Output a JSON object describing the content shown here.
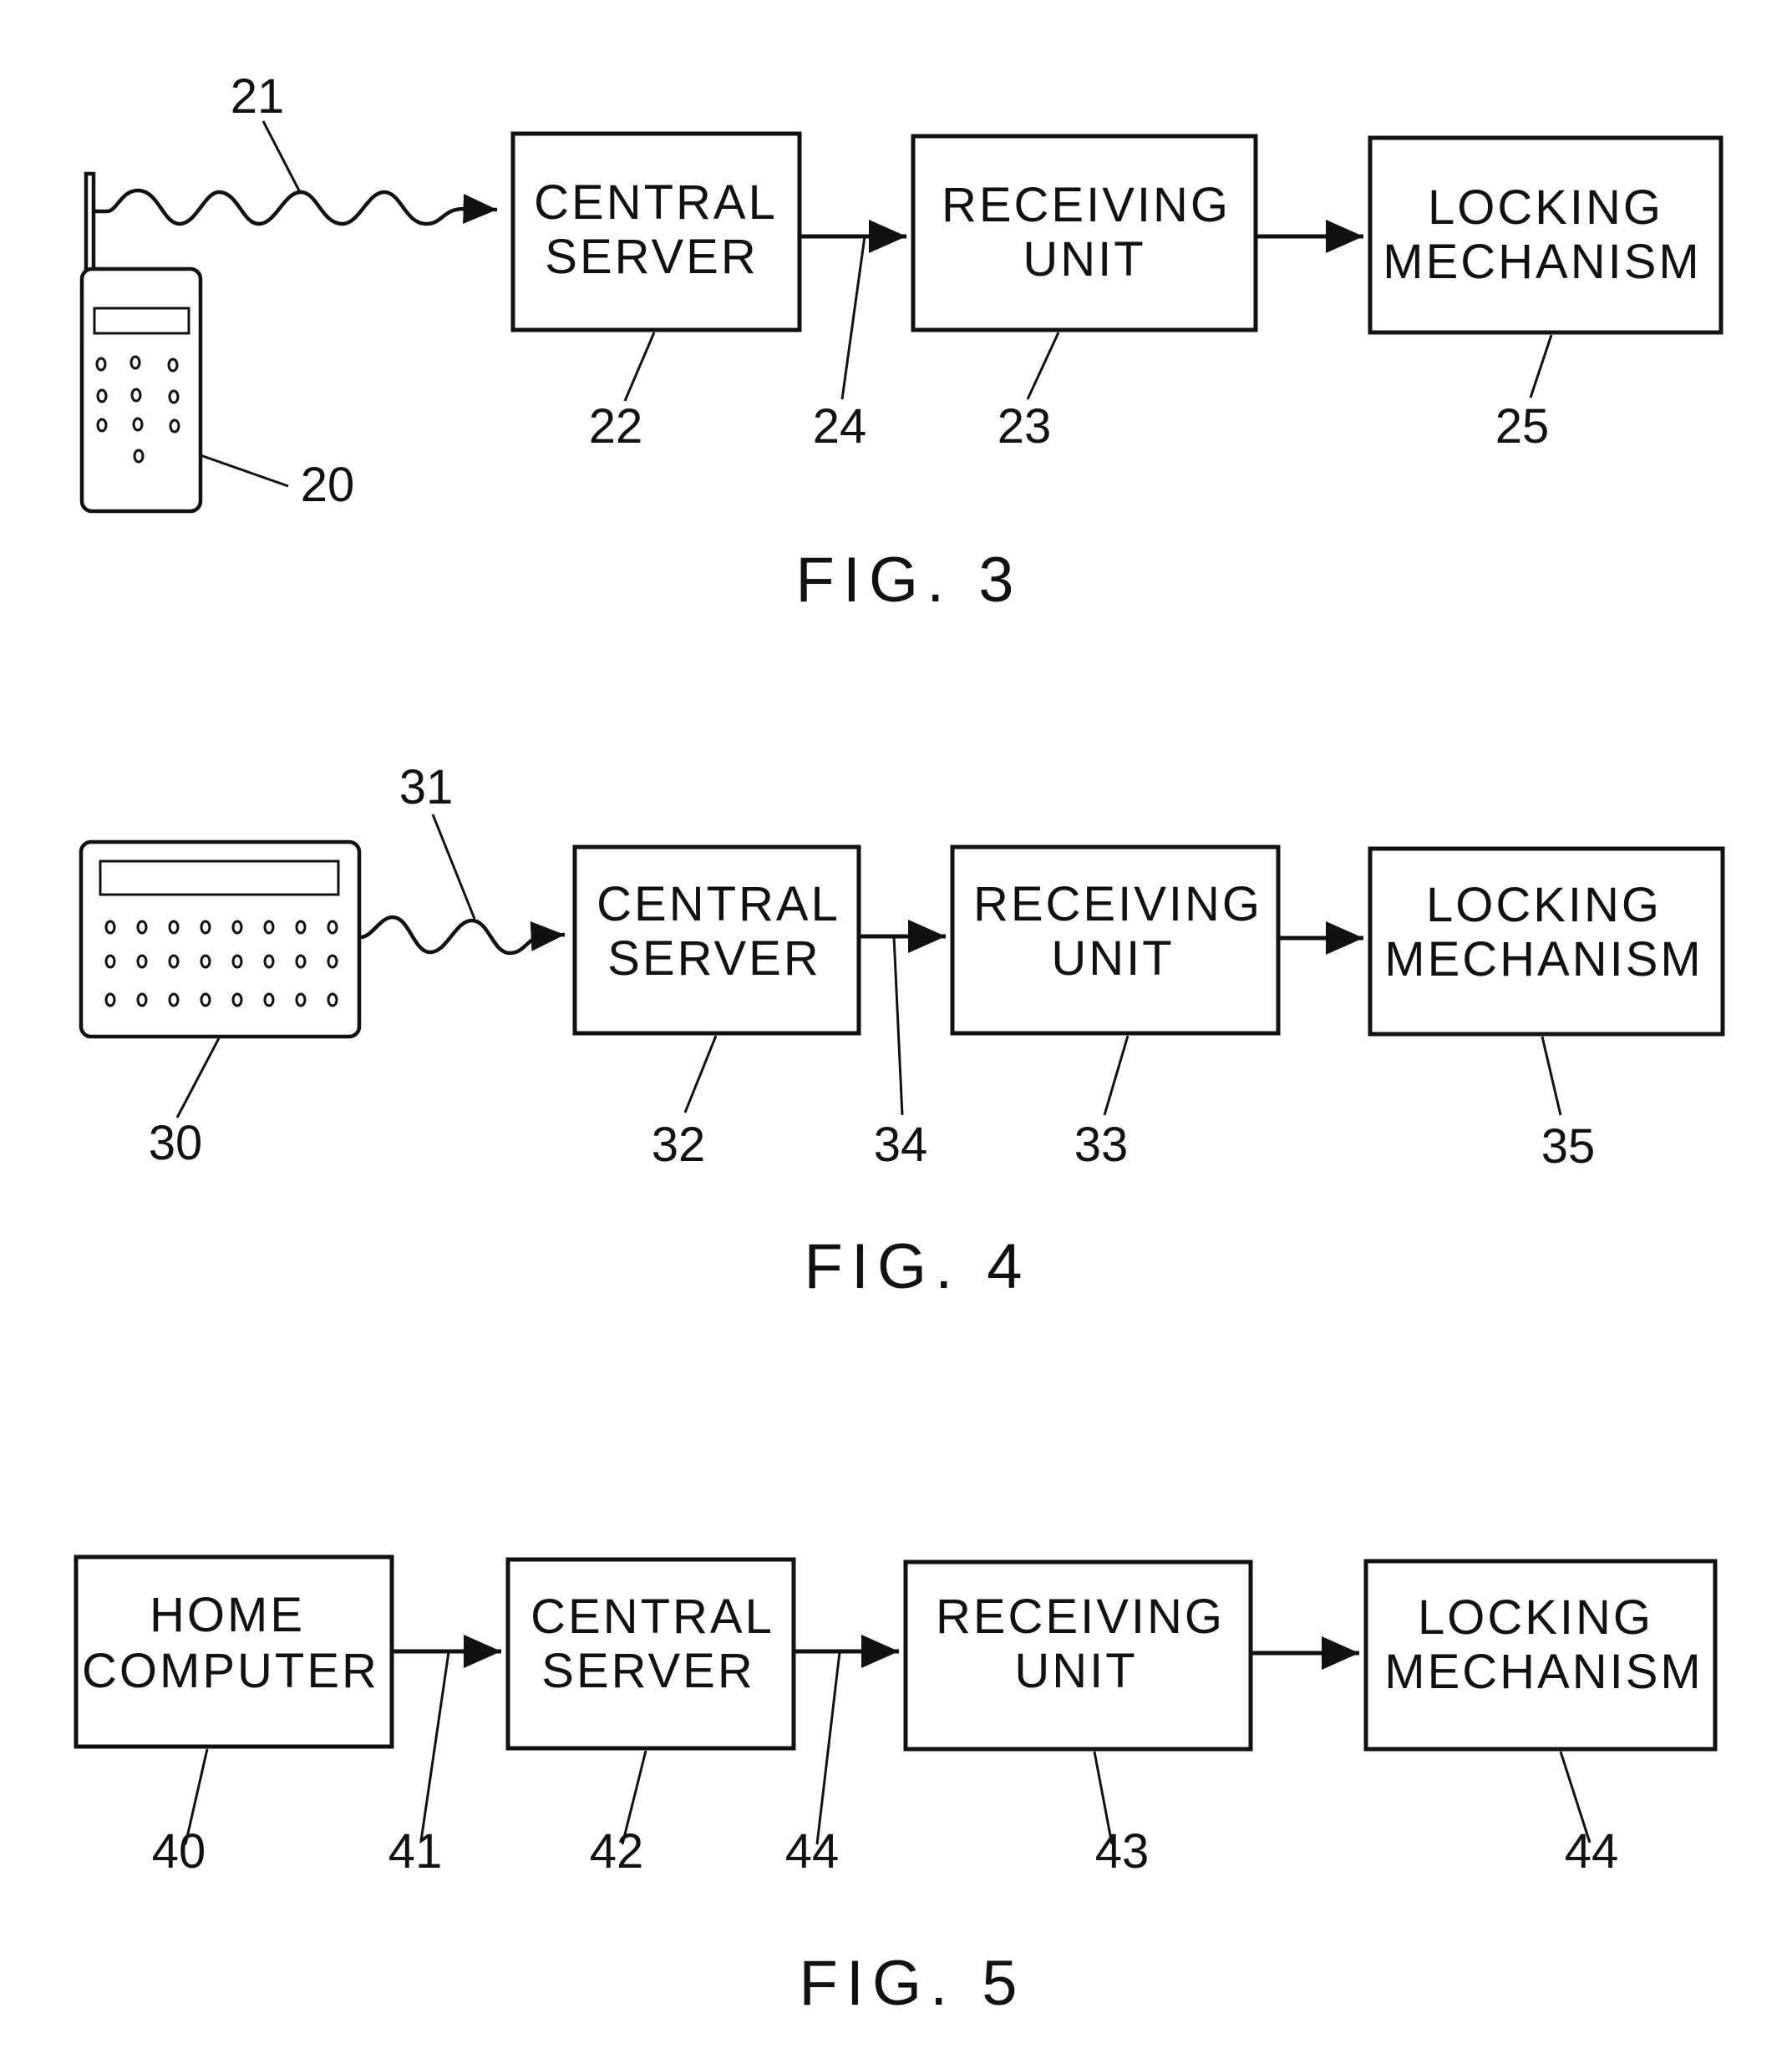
{
  "figures": [
    {
      "label": "FIG. 3",
      "source_device": {
        "type": "mobile-phone",
        "ref": "20"
      },
      "link_ref": "21",
      "link_type": "wireless",
      "blocks": [
        {
          "ref": "22",
          "lines": [
            "CENTRAL",
            "SERVER"
          ]
        },
        {
          "ref": "23",
          "lines": [
            "RECEIVING",
            "UNIT"
          ]
        },
        {
          "ref": "25",
          "lines": [
            "LOCKING",
            "MECHANISM"
          ]
        }
      ],
      "connection_refs": [
        "24"
      ]
    },
    {
      "label": "FIG. 4",
      "source_device": {
        "type": "keypad-device",
        "ref": "30"
      },
      "link_ref": "31",
      "link_type": "wireless",
      "blocks": [
        {
          "ref": "32",
          "lines": [
            "CENTRAL",
            "SERVER"
          ]
        },
        {
          "ref": "33",
          "lines": [
            "RECEIVING",
            "UNIT"
          ]
        },
        {
          "ref": "35",
          "lines": [
            "LOCKING",
            "MECHANISM"
          ]
        }
      ],
      "connection_refs": [
        "34"
      ]
    },
    {
      "label": "FIG. 5",
      "source_device": {
        "type": "block",
        "ref": "40",
        "lines": [
          "HOME",
          "COMPUTER"
        ]
      },
      "link_ref": "41",
      "link_type": "wired",
      "blocks": [
        {
          "ref": "42",
          "lines": [
            "CENTRAL",
            "SERVER"
          ]
        },
        {
          "ref": "43",
          "lines": [
            "RECEIVING",
            "UNIT"
          ]
        },
        {
          "ref": "44",
          "lines": [
            "LOCKING",
            "MECHANISM"
          ]
        }
      ],
      "connection_refs": [
        "44"
      ]
    }
  ]
}
